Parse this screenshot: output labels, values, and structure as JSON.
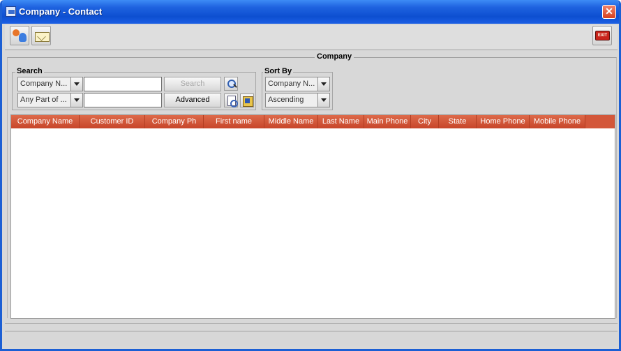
{
  "window": {
    "title": "Company - Contact",
    "close_symbol": "✕"
  },
  "toolbar": {
    "icons": [
      "people-icon",
      "mail-icon",
      "exit-icon"
    ],
    "exit_label": "EXIT"
  },
  "company_section": {
    "title": "Company"
  },
  "search": {
    "legend": "Search",
    "field_combo": "Company N...",
    "match_combo": "Any Part of ...",
    "field_value": "",
    "match_value": "",
    "search_button": "Search",
    "advanced_button": "Advanced"
  },
  "sort": {
    "legend": "Sort By",
    "field_combo": "Company N...",
    "order_combo": "Ascending"
  },
  "grid": {
    "columns": [
      "Company Name",
      "Customer ID",
      "Company Ph",
      "First name",
      "Middle Name",
      "Last Name",
      "Main Phone",
      "City",
      "State",
      "Home Phone",
      "Mobile Phone"
    ],
    "rows": []
  },
  "colors": {
    "title_bar": "#1f63e0",
    "grid_header": "#cd4d2d",
    "window_bg": "#d8d8d8"
  }
}
